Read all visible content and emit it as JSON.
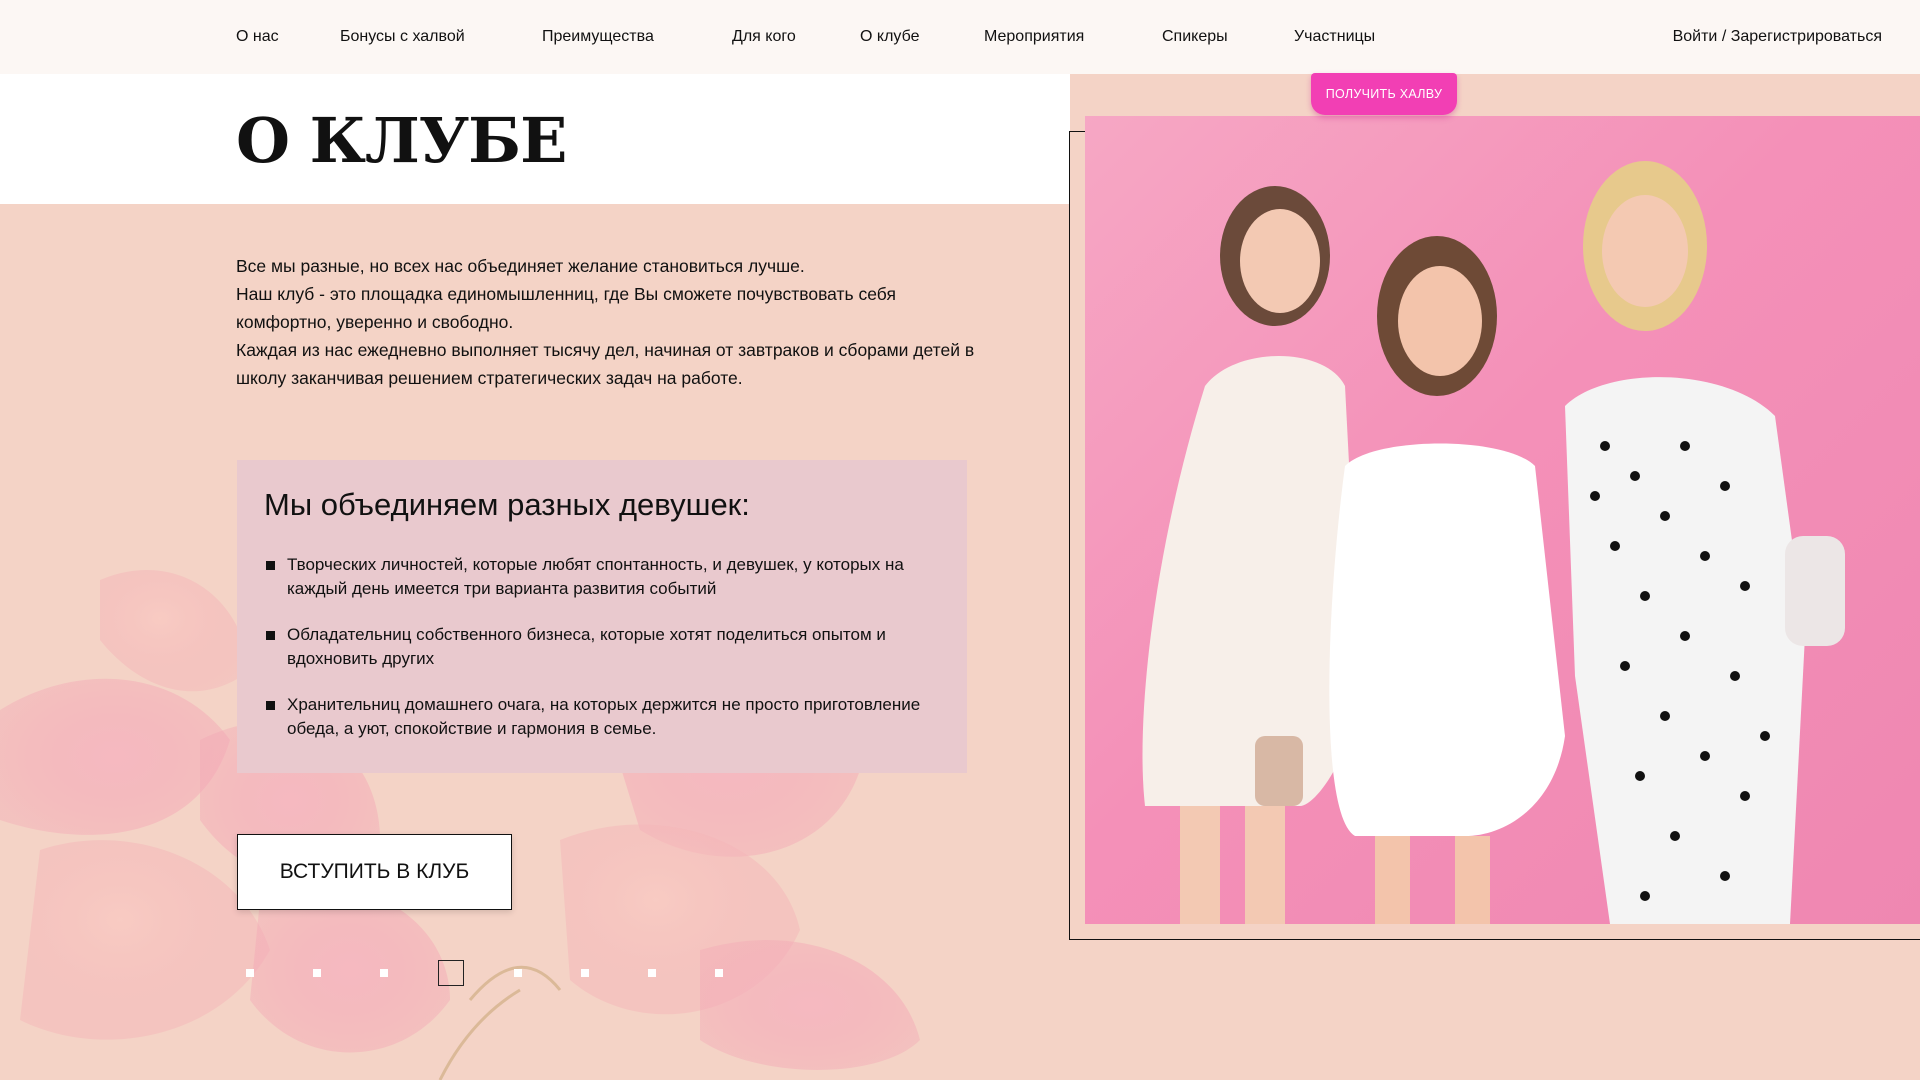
{
  "nav": {
    "items": [
      {
        "label": "О нас"
      },
      {
        "label": "Бонусы с халвой"
      },
      {
        "label": "Преимущества"
      },
      {
        "label": "Для кого"
      },
      {
        "label": "О клубе"
      },
      {
        "label": "Мероприятия"
      },
      {
        "label": "Спикеры"
      },
      {
        "label": "Участницы"
      }
    ],
    "login": "Войти / Зарегистрироваться"
  },
  "cta": {
    "label": "ПОЛУЧИТЬ ХАЛВУ"
  },
  "colors": {
    "accent_pink": "#f23fb4",
    "page_bg": "#f4d3c6",
    "box_bg": "#e9c9ce",
    "photo_bg": "#f490b8"
  },
  "section": {
    "title": "О КЛУБЕ",
    "intro": [
      "Все мы разные, но всех нас объединяет желание становиться лучше.",
      "Наш клуб - это площадка единомышленниц, где Вы сможете почувствовать себя комфортно, уверенно и свободно.",
      "Каждая из нас ежедневно выполняет тысячу дел, начиная от завтраков и сборами детей в школу заканчивая решением стратегических задач на работе."
    ],
    "unite": {
      "title": "Мы объединяем разных девушек:",
      "items": [
        "Творческих личностей, которые любят спонтанность, и девушек, у которых на каждый день имеется три варианта развития событий",
        "Обладательниц собственного бизнеса, которые хотят поделиться опытом и вдохновить других",
        "Хранительниц домашнего очага, на которых держится не просто приготовление обеда, а уют, спокойствие и гармония в семье."
      ]
    },
    "join_button": "ВСТУПИТЬ В КЛУБ"
  },
  "pagination": {
    "total": 8,
    "active": 4
  }
}
